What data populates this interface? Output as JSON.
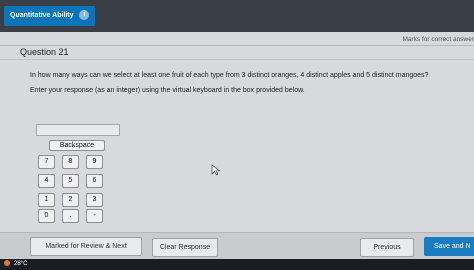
{
  "header": {
    "section_tab_label": "Quantitative Ability",
    "info_glyph": "i"
  },
  "marks_label": "Marks for correct answer",
  "question": {
    "title": "Question 21",
    "text": "In how many ways can we select at least one fruit of each type from 3 distinct oranges, 4 distinct apples and 5 distinct mangoes?",
    "instruction": "Enter your response (as an integer) using the virtual keyboard in the box provided below."
  },
  "answer_field": {
    "value": "",
    "placeholder": ""
  },
  "keypad": {
    "backspace_label": "Backspace",
    "keys": [
      "7",
      "8",
      "9",
      "4",
      "5",
      "6",
      "1",
      "2",
      "3",
      "0",
      ".",
      "-"
    ]
  },
  "footer": {
    "review_label": "Marked for Review & Next",
    "clear_label": "Clear Response",
    "previous_label": "Previous",
    "save_label": "Save and N"
  },
  "taskbar": {
    "temperature": "28°C",
    "weather_icon": "sun-icon"
  },
  "colors": {
    "accent": "#1a7cc0",
    "section_tab": "#0a76b8",
    "topbar": "#3a3f47"
  }
}
